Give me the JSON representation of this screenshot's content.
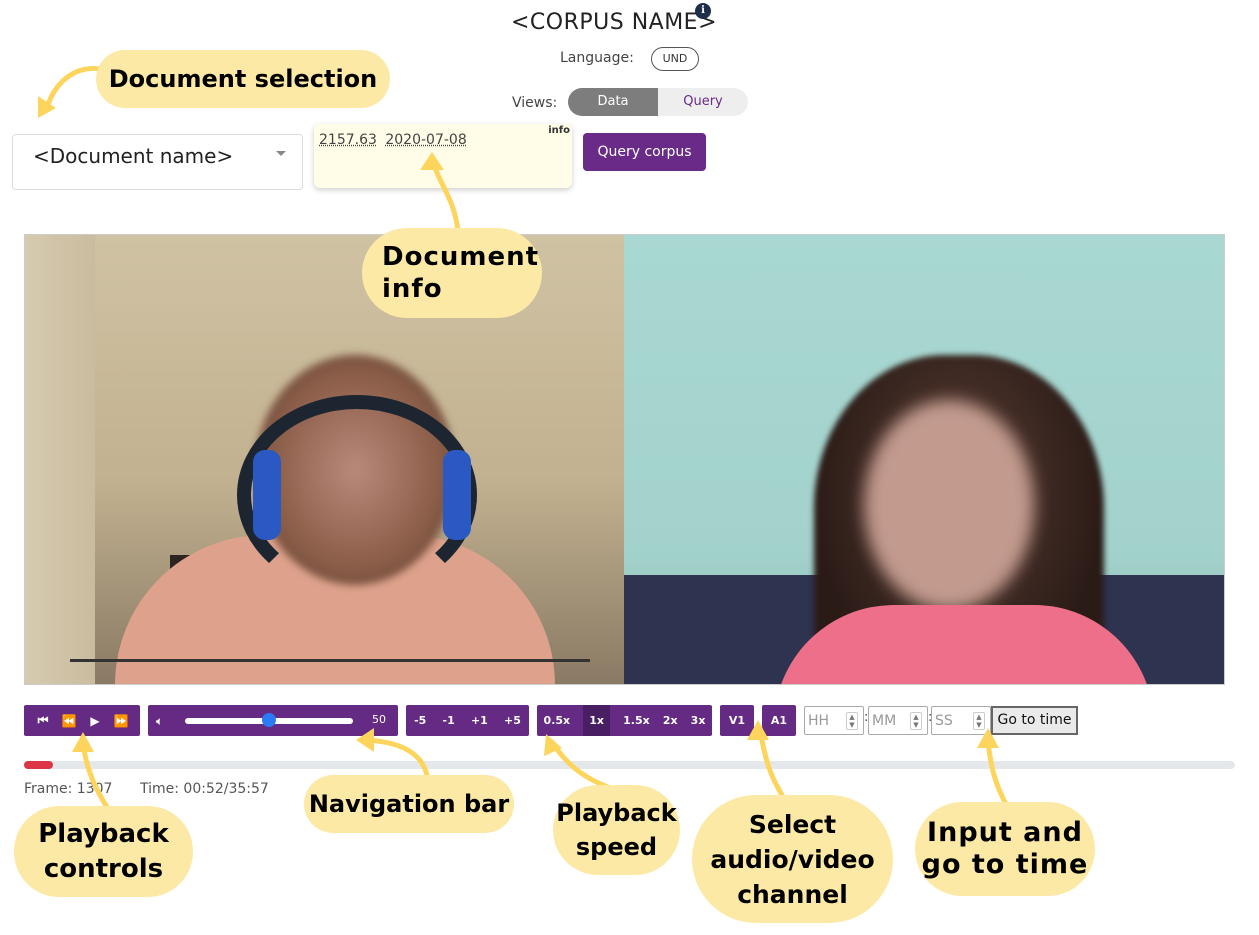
{
  "header": {
    "corpus_title": "<CORPUS NAME>",
    "info_icon": "i",
    "language_label": "Language:",
    "language_value": "UND",
    "views_label": "Views:",
    "views": [
      "Data",
      "Query"
    ],
    "views_active": "Data"
  },
  "document": {
    "selected": "<Document name>",
    "info_tag": "info",
    "info_values": [
      "2157.63",
      "2020-07-08"
    ],
    "query_button": "Query corpus"
  },
  "video": {
    "left_feed": "participant-1-video",
    "right_feed": "participant-2-video"
  },
  "controls": {
    "playback": [
      "⏮",
      "⏪",
      "▶",
      "⏩"
    ],
    "volume_icon": "speaker-icon",
    "volume_value": "50",
    "volume_level": 0.5,
    "nav": [
      "-5",
      "-1",
      "+1",
      "+5"
    ],
    "speed": [
      "0.5x",
      "1x",
      "1.5x",
      "2x",
      "3x"
    ],
    "speed_selected": "1x",
    "video_channel": "V1",
    "audio_channel": "A1",
    "hh_placeholder": "HH",
    "mm_placeholder": "MM",
    "ss_placeholder": "SS",
    "time_separator": ":",
    "goto_button": "Go to time"
  },
  "status": {
    "frame": "Frame: 1307",
    "time": "Time: 00:52/35:57",
    "progress_fraction": 0.024
  },
  "annotations": {
    "document_selection": "Document selection",
    "document_info": "Document\ninfo",
    "navigation_bar": "Navigation bar",
    "playback_controls": "Playback\ncontrols",
    "playback_speed": "Playback\nspeed",
    "select_channel": "Select\naudio/video\nchannel",
    "input_time": "Input and\ngo to time"
  },
  "colors": {
    "accent": "#642a84",
    "callout": "#fde9a6",
    "arrow": "#fdd55c",
    "progress": "#dc3545"
  }
}
